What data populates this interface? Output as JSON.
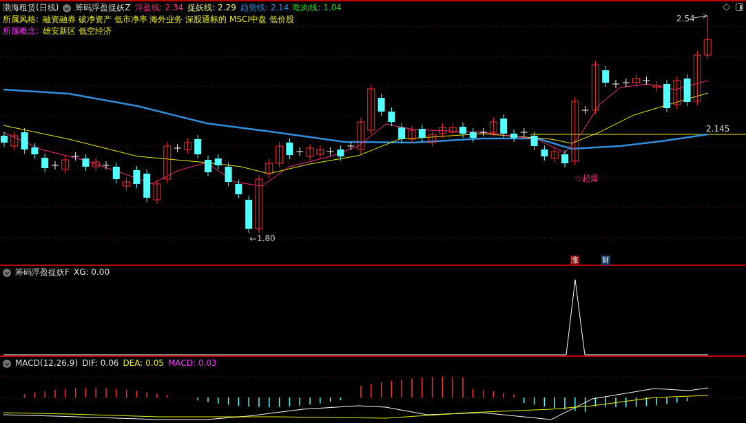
{
  "main_panel": {
    "stock": "渤海租赁(日线)",
    "indicator": "筹码浮盈捉妖Z",
    "values": [
      {
        "label": "浮盈线:",
        "value": "2.34",
        "color": "#ff2a8a"
      },
      {
        "label": "捉妖线:",
        "value": "2.29",
        "color": "#f0f07a"
      },
      {
        "label": "趋势线:",
        "value": "2.14",
        "color": "#2f8fe0"
      },
      {
        "label": "吃肉线:",
        "value": "1.04",
        "color": "#22dd22"
      }
    ],
    "style_line": {
      "label": "所属风格:",
      "text": "融资融券 破净资产 低市净率 海外业务 深股通标的 MSCI中盘 低价股"
    },
    "concept_line": {
      "label": "所属概念:",
      "text": "雄安新区 低空经济"
    },
    "high_label": "2.54",
    "low_label": "1.80",
    "level_label": "2.145",
    "signal_label": "☆起爆",
    "badges": [
      {
        "text": "涨",
        "color": "#8b0a0a"
      },
      {
        "text": "财",
        "color": "#0c3a6e"
      }
    ]
  },
  "signal_panel": {
    "indicator": "筹码浮盈捉妖F",
    "values": [
      {
        "label": "XG:",
        "value": "0.00",
        "color": "#e6e6e6"
      }
    ]
  },
  "macd_panel": {
    "indicator": "MACD(12,26,9)",
    "values": [
      {
        "label": "DIF:",
        "value": "0.06",
        "color": "#e6e6e6"
      },
      {
        "label": "DEA:",
        "value": "0.05",
        "color": "#f0f000"
      },
      {
        "label": "MACD:",
        "value": "0.03",
        "color": "#ff33ff"
      }
    ]
  }
}
